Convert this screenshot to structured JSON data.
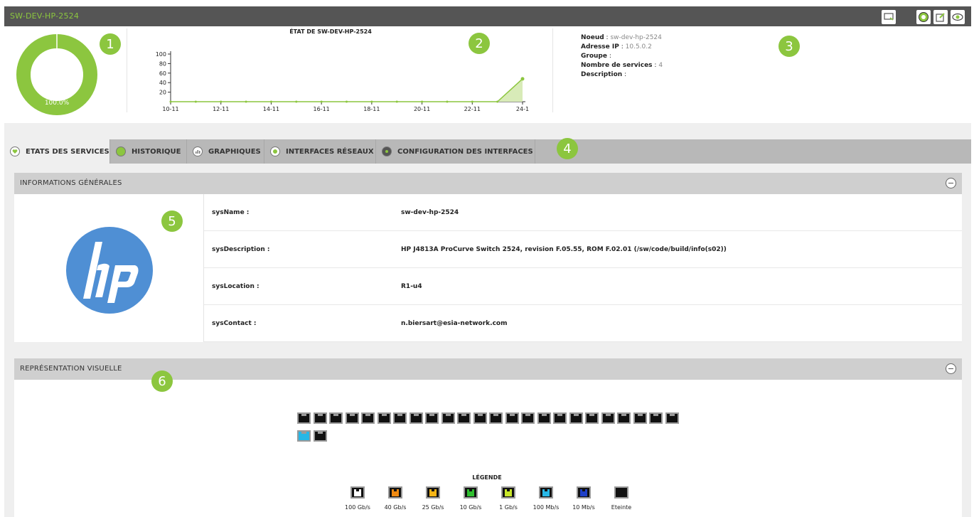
{
  "header": {
    "title": "SW-DEV-HP-2524"
  },
  "toolbar": {
    "icons": [
      "screen-icon",
      "history-icon",
      "edit-icon",
      "eye-icon"
    ]
  },
  "badges": [
    "1",
    "2",
    "3",
    "4",
    "5",
    "6"
  ],
  "donut": {
    "label": "100.0%",
    "value_percent": 100.0,
    "color": "#8cc63f"
  },
  "chart_data": {
    "type": "area",
    "title": "ÉTAT DE SW-DEV-HP-2524",
    "x_tick_labels": [
      "10-11",
      "12-11",
      "14-11",
      "16-11",
      "18-11",
      "20-11",
      "22-11",
      "24-1"
    ],
    "y_tick_labels": [
      "100",
      "80",
      "60",
      "40",
      "20"
    ],
    "ylim": [
      0,
      100
    ],
    "x": [
      0,
      1,
      2,
      3,
      4,
      5,
      6,
      7,
      8,
      9,
      10,
      11,
      12,
      13,
      14
    ],
    "values": [
      0,
      0,
      0,
      0,
      0,
      0,
      0,
      0,
      0,
      0,
      0,
      0,
      0,
      0,
      48
    ],
    "color": "#8cc63f"
  },
  "node_info": {
    "noeud_label": "Noeud",
    "noeud_value": "sw-dev-hp-2524",
    "ip_label": "Adresse IP",
    "ip_value": "10.5.0.2",
    "groupe_label": "Groupe",
    "groupe_value": "",
    "services_label": "Nombre de services",
    "services_value": "4",
    "description_label": "Description",
    "description_value": ""
  },
  "tabs": [
    {
      "label": "ETATS DES SERVICES",
      "icon": "heart-icon"
    },
    {
      "label": "HISTORIQUE",
      "icon": "history-icon"
    },
    {
      "label": "GRAPHIQUES",
      "icon": "bar-chart-icon"
    },
    {
      "label": "INTERFACES RÉSEAUX",
      "icon": "network-icon"
    },
    {
      "label": "CONFIGURATION DES INTERFACES",
      "icon": "settings-icon"
    }
  ],
  "general": {
    "title": "INFORMATIONS GÉNÉRALES",
    "logo_text": "hp",
    "rows": [
      {
        "key": "sysName :",
        "value": "sw-dev-hp-2524"
      },
      {
        "key": "sysDescription :",
        "value": "HP J4813A ProCurve Switch 2524, revision F.05.55, ROM F.02.01 (/sw/code/build/info(s02))"
      },
      {
        "key": "sysLocation :",
        "value": "R1-u4"
      },
      {
        "key": "sysContact :",
        "value": "n.biersart@esia-network.com"
      }
    ]
  },
  "visual": {
    "title": "REPRÉSENTATION VISUELLE",
    "ports_row1_count": 24,
    "ports_row2": [
      "100 Mb/s",
      "Eteinte"
    ],
    "legend_title": "LÉGENDE",
    "legend": [
      {
        "label": "100 Gb/s",
        "color": "#ffffff"
      },
      {
        "label": "40 Gb/s",
        "color": "#f08a12"
      },
      {
        "label": "25 Gb/s",
        "color": "#f7b516"
      },
      {
        "label": "10 Gb/s",
        "color": "#2fbf2f"
      },
      {
        "label": "1 Gb/s",
        "color": "#c8e62a"
      },
      {
        "label": "100 Mb/s",
        "color": "#27b7e6"
      },
      {
        "label": "10 Mb/s",
        "color": "#1e40c8"
      },
      {
        "label": "Eteinte",
        "color": "#111111"
      }
    ]
  }
}
